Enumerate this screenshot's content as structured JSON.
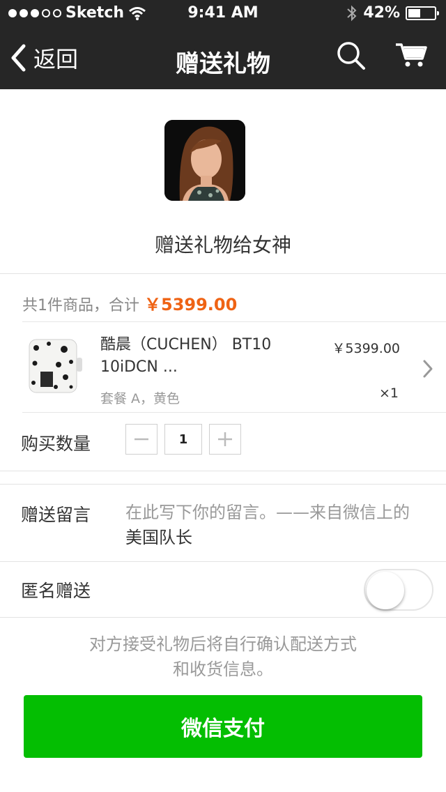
{
  "status_bar": {
    "carrier": "Sketch",
    "time": "9:41 AM",
    "battery_percent": "42%",
    "battery_level": 0.42,
    "signal_bars_filled": 3,
    "signal_bars_total": 5
  },
  "nav": {
    "back_label": "返回",
    "title": "赠送礼物",
    "icons": [
      "search-icon",
      "cart-icon"
    ]
  },
  "profile": {
    "caption": "赠送礼物给女神"
  },
  "order": {
    "summary_prefix": "共1件商品，合计",
    "total": "￥5399.00",
    "product": {
      "name": "酷晨（CUCHEN） BT10 10iDCN ...",
      "spec": "套餐 A，黄色",
      "price": "￥5399.00",
      "quantity": "×1"
    },
    "quantity_label": "购买数量",
    "quantity_value": "1"
  },
  "message": {
    "label": "赠送留言",
    "placeholder": "在此写下你的留言。——来自微信上的",
    "signature": "美国队长"
  },
  "anonymous": {
    "label": "匿名赠送",
    "enabled": false
  },
  "note": {
    "line1": "对方接受礼物后将自行确认配送方式",
    "line2": "和收货信息。"
  },
  "pay_button": "微信支付",
  "colors": {
    "nav_bg": "#262626",
    "accent_price": "#ef6314",
    "pay_green": "#04be02"
  }
}
